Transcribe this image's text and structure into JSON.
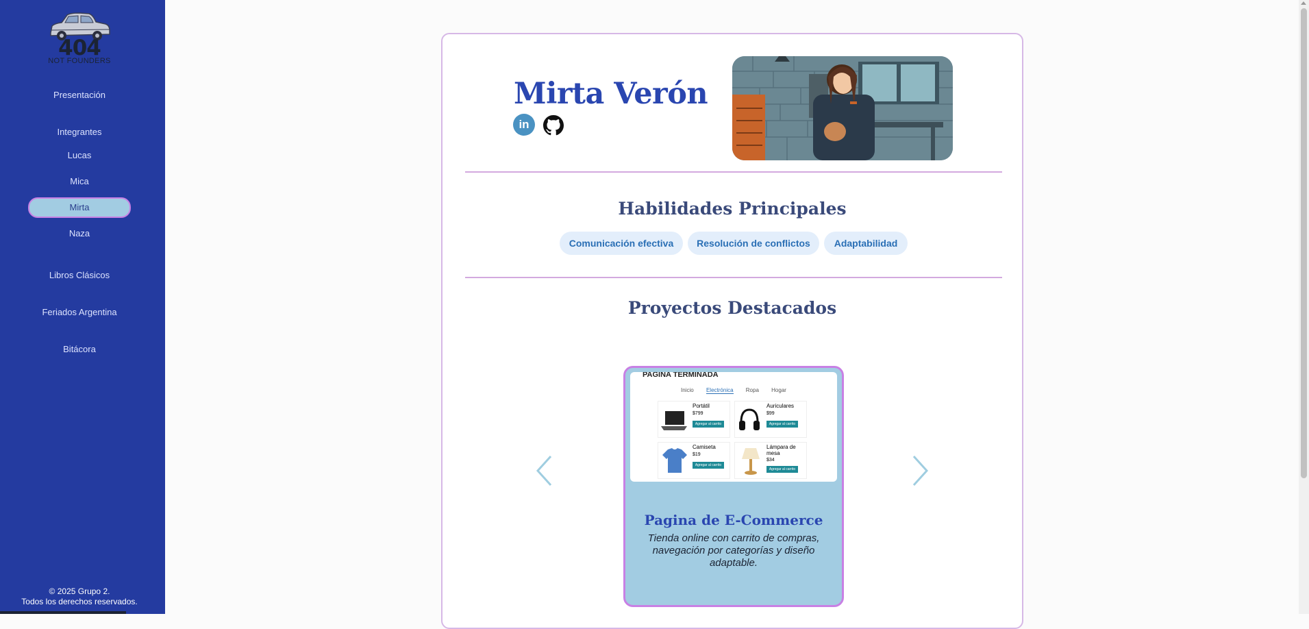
{
  "sidebar": {
    "logo": {
      "number": "404",
      "subtitle": "NOT FOUNDERS"
    },
    "nav": {
      "presentacion": "Presentación",
      "integrantes": "Integrantes",
      "lucas": "Lucas",
      "mica": "Mica",
      "mirta": "Mirta",
      "naza": "Naza",
      "libros": "Libros Clásicos",
      "feriados": "Feriados Argentina",
      "bitacora": "Bitácora"
    },
    "footer": {
      "line1": "© 2025 Grupo 2.",
      "line2": "Todos los derechos reservados."
    }
  },
  "profile": {
    "name": "Mirta Verón",
    "linkedin_label": "in"
  },
  "skills": {
    "title": "Habilidades Principales",
    "items": [
      "Comunicación efectiva",
      "Resolución de conflictos",
      "Adaptabilidad"
    ]
  },
  "projects": {
    "title": "Proyectos Destacados",
    "current": {
      "title": "Pagina de E-Commerce",
      "description": "Tienda online con carrito de compras, navegación por categorías y diseño adaptable.",
      "screenshot": {
        "header": "PAGINA TERMINADA",
        "tabs": [
          "Inicio",
          "Electrónica",
          "Ropa",
          "Hogar"
        ],
        "products": [
          {
            "name": "Portátil",
            "price": "$799"
          },
          {
            "name": "Auriculares",
            "price": "$99"
          },
          {
            "name": "Camiseta",
            "price": "$19"
          },
          {
            "name": "Lámpara de mesa",
            "price": "$34"
          }
        ],
        "button": "Agregar al carrito"
      }
    }
  },
  "colors": {
    "sidebar": "#243ba0",
    "accent_border": "#c880e4",
    "active_fill": "#a2cce2",
    "name": "#2a46b0",
    "section_title": "#3a4a7a",
    "pill_bg": "#e3eefb",
    "pill_text": "#2a6fb5"
  },
  "icons": [
    "car-logo-icon",
    "linkedin-icon",
    "github-icon",
    "chevron-left-icon",
    "chevron-right-icon"
  ]
}
